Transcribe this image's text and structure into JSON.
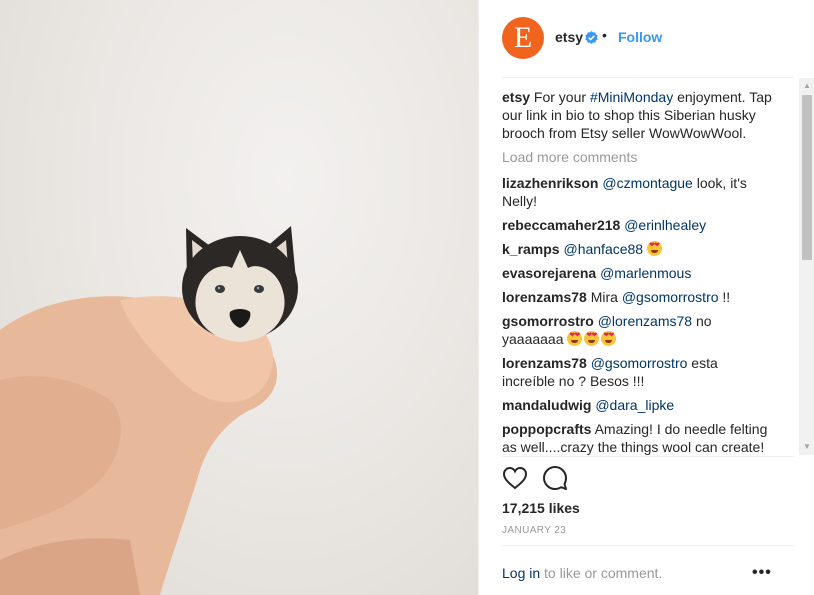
{
  "post": {
    "username": "etsy",
    "avatar_letter": "E",
    "bullet": "•",
    "follow_label": "Follow",
    "caption": {
      "user": "etsy",
      "text_before": "For your ",
      "hashtag": "#MiniMonday",
      "text_after": " enjoyment. Tap our link in bio to shop this Siberian husky brooch from Etsy seller WowWowWool."
    },
    "load_more": "Load more comments",
    "comments": [
      {
        "user": "lizazhenrikson",
        "mention": "@czmontague",
        "text": " look, it's Nelly!"
      },
      {
        "user": "rebeccamaher218",
        "mention": "@erinlhealey",
        "text": ""
      },
      {
        "user": "k_ramps",
        "mention": "@hanface88",
        "text": " "
      },
      {
        "user": "evasorejarena",
        "mention": "@marlenmous",
        "text": ""
      },
      {
        "user": "lorenzams78",
        "prefix": "Mira ",
        "mention": "@gsomorrostro",
        "text": " !!"
      },
      {
        "user": "gsomorrostro",
        "mention": "@lorenzams78",
        "text": " no yaaaaaaa "
      },
      {
        "user": "lorenzams78",
        "mention": "@gsomorrostro",
        "text": " esta increíble no ? Besos !!!"
      },
      {
        "user": "mandaludwig",
        "mention": "@dara_lipke",
        "text": ""
      },
      {
        "user": "poppopcrafts",
        "mention": "",
        "text": "Amazing! I do needle felting as well....crazy the things wool can create!"
      }
    ],
    "likes": "17,215 likes",
    "date": "JANUARY 23",
    "login_link": "Log in",
    "login_text": " to like or comment.",
    "more_options": "•••",
    "icons": [
      "heart-icon",
      "comment-icon",
      "verified-badge-icon",
      "more-options-icon"
    ],
    "colors": {
      "avatar": "#f1641e",
      "follow": "#3897f0",
      "link": "#003569",
      "muted": "#999999"
    }
  }
}
